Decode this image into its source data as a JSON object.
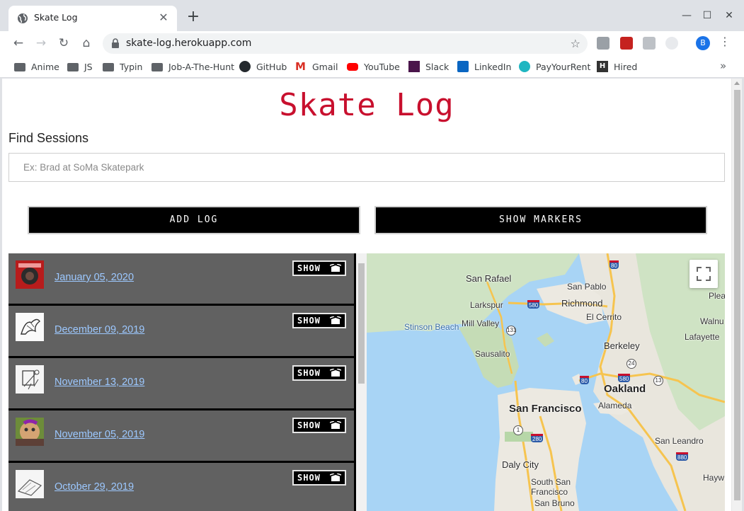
{
  "browser": {
    "tab_title": "Skate Log",
    "url": "skate-log.herokuapp.com",
    "profile_initial": "B",
    "bookmarks": [
      {
        "label": "Anime",
        "icon": "folder-icon"
      },
      {
        "label": "JS",
        "icon": "folder-icon"
      },
      {
        "label": "Typin",
        "icon": "folder-icon"
      },
      {
        "label": "Job-A-The-Hunt",
        "icon": "folder-icon"
      },
      {
        "label": "GitHub",
        "icon": "github-icon"
      },
      {
        "label": "Gmail",
        "icon": "gmail-icon"
      },
      {
        "label": "YouTube",
        "icon": "youtube-icon"
      },
      {
        "label": "Slack",
        "icon": "slack-icon"
      },
      {
        "label": "LinkedIn",
        "icon": "linkedin-icon"
      },
      {
        "label": "PayYourRent",
        "icon": "payyourrent-icon"
      },
      {
        "label": "Hired",
        "icon": "hired-icon"
      }
    ],
    "bookmarks_more": "»"
  },
  "page": {
    "title": "Skate Log",
    "title_color": "#c8102e",
    "find_label": "Find Sessions",
    "search_placeholder": "Ex: Brad at SoMa Skatepark",
    "add_log_label": "ADD LOG",
    "show_markers_label": "SHOW MARKERS"
  },
  "sessions": [
    {
      "date": "January 05, 2020",
      "show_label": "SHOW"
    },
    {
      "date": "December 09, 2019",
      "show_label": "SHOW"
    },
    {
      "date": "November 13, 2019",
      "show_label": "SHOW"
    },
    {
      "date": "November 05, 2019",
      "show_label": "SHOW"
    },
    {
      "date": "October 29, 2019",
      "show_label": "SHOW"
    }
  ],
  "map": {
    "labels": [
      {
        "text": "San Rafael",
        "kind": "city"
      },
      {
        "text": "San Pablo",
        "kind": "small"
      },
      {
        "text": "Larkspur",
        "kind": "small"
      },
      {
        "text": "Richmond",
        "kind": "city"
      },
      {
        "text": "Plea",
        "kind": "small"
      },
      {
        "text": "El Cerrito",
        "kind": "small"
      },
      {
        "text": "Stinson Beach",
        "kind": "small"
      },
      {
        "text": "Mill Valley",
        "kind": "small"
      },
      {
        "text": "Walnu",
        "kind": "small"
      },
      {
        "text": "Lafayette",
        "kind": "small"
      },
      {
        "text": "Berkeley",
        "kind": "city"
      },
      {
        "text": "Sausalito",
        "kind": "small"
      },
      {
        "text": "Oakland",
        "kind": "big"
      },
      {
        "text": "San Francisco",
        "kind": "big"
      },
      {
        "text": "Alameda",
        "kind": "small"
      },
      {
        "text": "San Leandro",
        "kind": "small"
      },
      {
        "text": "Daly City",
        "kind": "city"
      },
      {
        "text": "South San",
        "kind": "small"
      },
      {
        "text": "Francisco",
        "kind": "small"
      },
      {
        "text": "San Bruno",
        "kind": "small"
      },
      {
        "text": "Hayw",
        "kind": "small"
      }
    ],
    "shields": [
      "80",
      "580",
      "131",
      "24",
      "80",
      "580",
      "13",
      "1",
      "280",
      "880"
    ]
  }
}
